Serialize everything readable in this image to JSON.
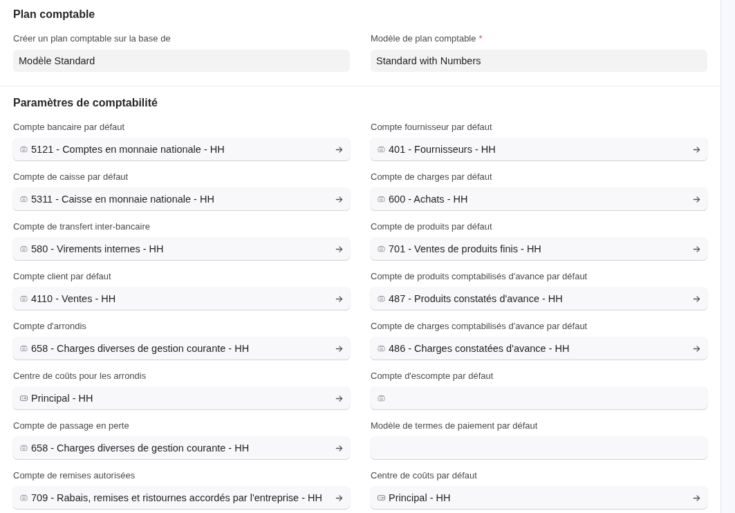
{
  "sections": [
    {
      "title": "Plan comptable",
      "fields": [
        {
          "label": "Créer un plan comptable sur la base de",
          "kind": "select",
          "value": "Modèle Standard"
        },
        {
          "label": "Modèle de plan comptable",
          "required_mark": "*",
          "kind": "select",
          "value": "Standard with Numbers"
        }
      ]
    },
    {
      "title": "Paramètres de comptabilité",
      "fields": [
        {
          "label": "Compte bancaire par défaut",
          "kind": "account",
          "value": "5121 - Comptes en monnaie nationale - HH"
        },
        {
          "label": "Compte fournisseur par défaut",
          "kind": "account",
          "value": "401 - Fournisseurs - HH"
        },
        {
          "label": "Compte de caisse par défaut",
          "kind": "account",
          "value": "5311 - Caisse en monnaie nationale - HH"
        },
        {
          "label": "Compte de charges par défaut",
          "kind": "account",
          "value": "600 - Achats - HH"
        },
        {
          "label": "Compte de transfert inter-bancaire",
          "kind": "account",
          "value": "580 - Virements internes - HH"
        },
        {
          "label": "Compte de produits par défaut",
          "kind": "account",
          "value": "701 - Ventes de produits finis - HH"
        },
        {
          "label": "Compte client par défaut",
          "kind": "account",
          "value": "4110 - Ventes - HH"
        },
        {
          "label": "Compte de produits comptabilisés d'avance par défaut",
          "kind": "account",
          "value": "487 - Produits constatés d'avance - HH"
        },
        {
          "label": "Compte d'arrondis",
          "kind": "account",
          "value": "658 - Charges diverses de gestion courante - HH"
        },
        {
          "label": "Compte de charges comptabilisés d'avance par défaut",
          "kind": "account",
          "value": "486 - Charges constatées d'avance - HH"
        },
        {
          "label": "Centre de coûts pour les arrondis",
          "kind": "cost_center",
          "value": "Principal - HH"
        },
        {
          "label": "Compte d'escompte par défaut",
          "kind": "account"
        },
        {
          "label": "Compte de passage en perte",
          "kind": "account",
          "value": "658 - Charges diverses de gestion courante - HH"
        },
        {
          "label": "Modèle de termes de paiement par défaut",
          "kind": "plain"
        },
        {
          "label": "Compte de remises autorisées",
          "kind": "account",
          "value": "709 - Rabais, remises et ristournes accordés par l'entreprise - HH"
        },
        {
          "label": "Centre de coûts par défaut",
          "kind": "cost_center",
          "value": "Principal - HH"
        }
      ]
    }
  ]
}
